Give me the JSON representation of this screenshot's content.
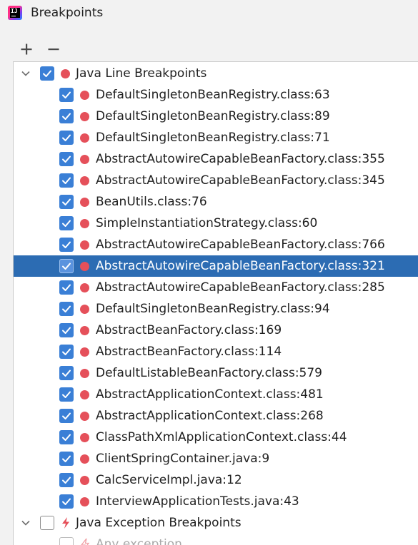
{
  "window": {
    "title": "Breakpoints",
    "app_icon": "intellij-idea-logo"
  },
  "toolbar": {
    "add_symbol": "+",
    "remove_symbol": "−"
  },
  "colors": {
    "selection": "#2c6cb3",
    "checkbox": "#3a7fd6",
    "breakpoint": "#e5505a"
  },
  "tree": {
    "groups": [
      {
        "label": "Java Line Breakpoints",
        "checked": true,
        "expanded": true,
        "icon": "breakpoint-dot-icon",
        "items": [
          {
            "label": "DefaultSingletonBeanRegistry.class:63",
            "checked": true
          },
          {
            "label": "DefaultSingletonBeanRegistry.class:89",
            "checked": true
          },
          {
            "label": "DefaultSingletonBeanRegistry.class:71",
            "checked": true
          },
          {
            "label": "AbstractAutowireCapableBeanFactory.class:355",
            "checked": true
          },
          {
            "label": "AbstractAutowireCapableBeanFactory.class:345",
            "checked": true
          },
          {
            "label": "BeanUtils.class:76",
            "checked": true
          },
          {
            "label": "SimpleInstantiationStrategy.class:60",
            "checked": true
          },
          {
            "label": "AbstractAutowireCapableBeanFactory.class:766",
            "checked": true
          },
          {
            "label": "AbstractAutowireCapableBeanFactory.class:321",
            "checked": true,
            "selected": true
          },
          {
            "label": "AbstractAutowireCapableBeanFactory.class:285",
            "checked": true
          },
          {
            "label": "DefaultSingletonBeanRegistry.class:94",
            "checked": true
          },
          {
            "label": "AbstractBeanFactory.class:169",
            "checked": true
          },
          {
            "label": "AbstractBeanFactory.class:114",
            "checked": true
          },
          {
            "label": "DefaultListableBeanFactory.class:579",
            "checked": true
          },
          {
            "label": "AbstractApplicationContext.class:481",
            "checked": true
          },
          {
            "label": "AbstractApplicationContext.class:268",
            "checked": true
          },
          {
            "label": "ClassPathXmlApplicationContext.class:44",
            "checked": true
          },
          {
            "label": "ClientSpringContainer.java:9",
            "checked": true
          },
          {
            "label": "CalcServiceImpl.java:12",
            "checked": true
          },
          {
            "label": "InterviewApplicationTests.java:43",
            "checked": true
          }
        ]
      },
      {
        "label": "Java Exception Breakpoints",
        "checked": false,
        "expanded": true,
        "icon": "lightning-bolt-icon",
        "items": [
          {
            "label": "Any exception",
            "checked": false,
            "faded": true
          }
        ]
      }
    ]
  }
}
